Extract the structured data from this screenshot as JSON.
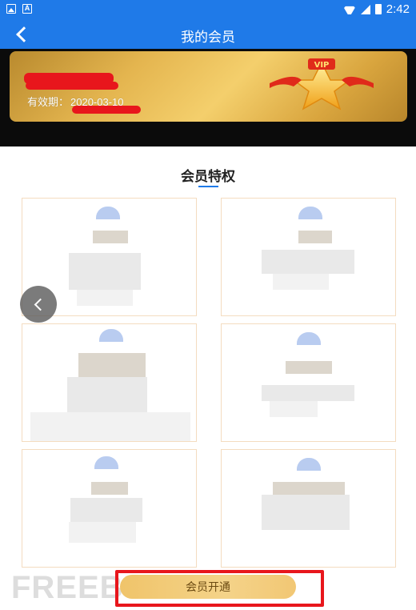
{
  "status_bar": {
    "time": "2:42"
  },
  "app_bar": {
    "title": "我的会员"
  },
  "vip_card": {
    "expiry_label": "有效期：",
    "expiry_date": "2020-03-10",
    "badge_text": "VIP"
  },
  "privileges": {
    "title": "会员特权"
  },
  "actions": {
    "open_membership": "会员开通"
  },
  "watermark": "FREEBUF",
  "colors": {
    "primary": "#1f7ae8",
    "gold": "#e4b54f",
    "redaction": "#e8161c"
  }
}
